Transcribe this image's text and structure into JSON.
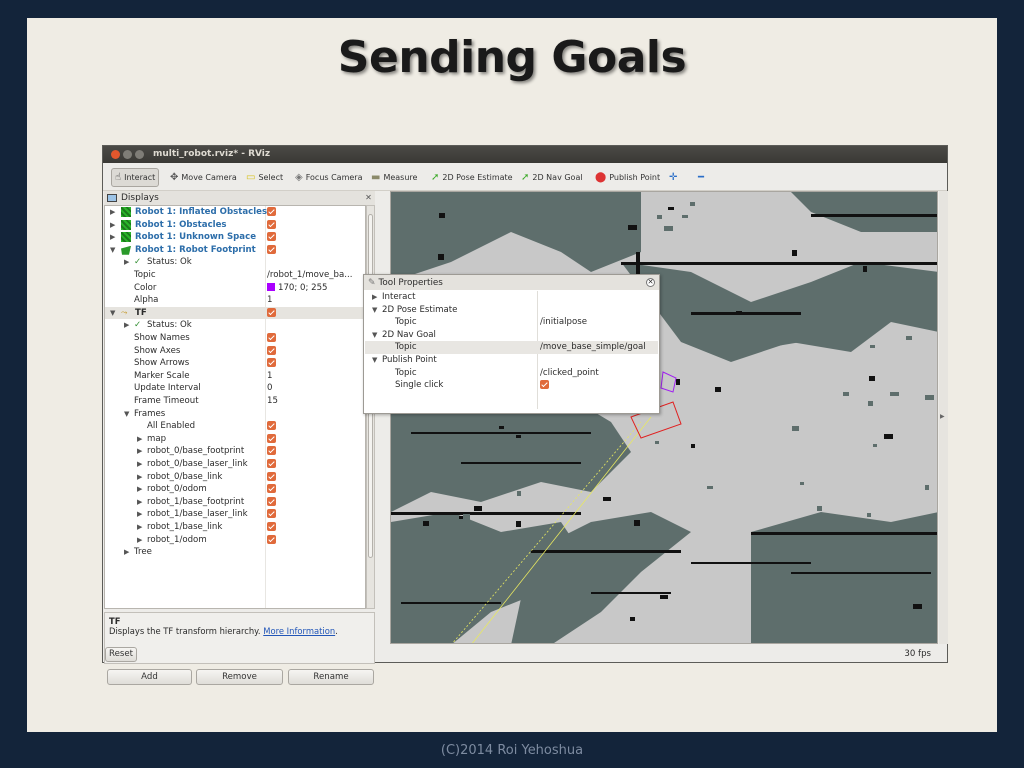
{
  "slide": {
    "title": "Sending Goals",
    "footer": "(C)2014 Roi Yehoshua"
  },
  "window": {
    "title": "multi_robot.rviz* - RViz"
  },
  "toolbar": {
    "tools": [
      {
        "label": "Interact",
        "icon": "hand-icon",
        "glyph": "☝",
        "active": true
      },
      {
        "label": "Move Camera",
        "icon": "move-camera-icon",
        "glyph": "✥"
      },
      {
        "label": "Select",
        "icon": "select-icon",
        "glyph": "▭"
      },
      {
        "label": "Focus Camera",
        "icon": "focus-camera-icon",
        "glyph": "◈"
      },
      {
        "label": "Measure",
        "icon": "measure-icon",
        "glyph": "▬"
      },
      {
        "label": "2D Pose Estimate",
        "icon": "pose-estimate-icon",
        "glyph": "➚"
      },
      {
        "label": "2D Nav Goal",
        "icon": "nav-goal-icon",
        "glyph": "➚"
      },
      {
        "label": "Publish Point",
        "icon": "map-pin-icon",
        "glyph": "⬤"
      },
      {
        "label": "",
        "icon": "plus-icon",
        "glyph": "✛"
      },
      {
        "label": "",
        "icon": "minus-icon",
        "glyph": "━"
      }
    ]
  },
  "displays": {
    "header": "Displays",
    "rows": [
      {
        "label": "Robot 1: Inflated Obstacles",
        "indent": 0,
        "arrow": "▶",
        "icon": "grid-icon",
        "blue": true,
        "checked": true
      },
      {
        "label": "Robot 1: Obstacles",
        "indent": 0,
        "arrow": "▶",
        "icon": "grid-icon",
        "blue": true,
        "checked": true
      },
      {
        "label": "Robot 1: Unknown Space",
        "indent": 0,
        "arrow": "▶",
        "icon": "grid-icon",
        "blue": true,
        "checked": true
      },
      {
        "label": "Robot 1: Robot Footprint",
        "indent": 0,
        "arrow": "▼",
        "icon": "footprint-icon",
        "blue": true,
        "checked": true
      },
      {
        "label": "Status: Ok",
        "indent": 1,
        "arrow": "▶",
        "status": true
      },
      {
        "label": "Topic",
        "indent": 2,
        "value": "/robot_1/move_ba..."
      },
      {
        "label": "Color",
        "indent": 2,
        "value": "170; 0; 255",
        "swatch": "#aa00ff"
      },
      {
        "label": "Alpha",
        "indent": 2,
        "value": "1"
      },
      {
        "label": "TF",
        "indent": 0,
        "arrow": "▼",
        "icon": "tf-icon",
        "bold": true,
        "checked": true,
        "highlight": true
      },
      {
        "label": "Status: Ok",
        "indent": 1,
        "arrow": "▶",
        "status": true
      },
      {
        "label": "Show Names",
        "indent": 2,
        "checked": true
      },
      {
        "label": "Show Axes",
        "indent": 2,
        "checked": true
      },
      {
        "label": "Show Arrows",
        "indent": 2,
        "checked": true
      },
      {
        "label": "Marker Scale",
        "indent": 2,
        "value": "1"
      },
      {
        "label": "Update Interval",
        "indent": 2,
        "value": "0"
      },
      {
        "label": "Frame Timeout",
        "indent": 2,
        "value": "15"
      },
      {
        "label": "Frames",
        "indent": 1,
        "arrow": "▼"
      },
      {
        "label": "All Enabled",
        "indent": 3,
        "checked": true
      },
      {
        "label": "map",
        "indent": 3,
        "arrow": "▶",
        "checked": true
      },
      {
        "label": "robot_0/base_footprint",
        "indent": 3,
        "arrow": "▶",
        "checked": true
      },
      {
        "label": "robot_0/base_laser_link",
        "indent": 3,
        "arrow": "▶",
        "checked": true
      },
      {
        "label": "robot_0/base_link",
        "indent": 3,
        "arrow": "▶",
        "checked": true
      },
      {
        "label": "robot_0/odom",
        "indent": 3,
        "arrow": "▶",
        "checked": true
      },
      {
        "label": "robot_1/base_footprint",
        "indent": 3,
        "arrow": "▶",
        "checked": true
      },
      {
        "label": "robot_1/base_laser_link",
        "indent": 3,
        "arrow": "▶",
        "checked": true
      },
      {
        "label": "robot_1/base_link",
        "indent": 3,
        "arrow": "▶",
        "checked": true
      },
      {
        "label": "robot_1/odom",
        "indent": 3,
        "arrow": "▶",
        "checked": true
      },
      {
        "label": "Tree",
        "indent": 1,
        "arrow": "▶"
      }
    ],
    "description": {
      "title": "TF",
      "text": "Displays the TF transform hierarchy. ",
      "link": "More Information",
      "tail": "."
    },
    "buttons": {
      "add": "Add",
      "remove": "Remove",
      "rename": "Rename"
    }
  },
  "tool_properties": {
    "title": "Tool Properties",
    "rows": [
      {
        "label": "Interact",
        "indent": 0,
        "arrow": "▶"
      },
      {
        "label": "2D Pose Estimate",
        "indent": 0,
        "arrow": "▼"
      },
      {
        "label": "Topic",
        "indent": 2,
        "value": "/initialpose"
      },
      {
        "label": "2D Nav Goal",
        "indent": 0,
        "arrow": "▼"
      },
      {
        "label": "Topic",
        "indent": 2,
        "value": "/move_base_simple/goal",
        "highlight": true
      },
      {
        "label": "Publish Point",
        "indent": 0,
        "arrow": "▼"
      },
      {
        "label": "Topic",
        "indent": 2,
        "value": "/clicked_point"
      },
      {
        "label": "Single click",
        "indent": 2,
        "checked": true
      }
    ]
  },
  "statusbar": {
    "reset": "Reset",
    "fps": "30 fps"
  },
  "colors": {
    "checkbox": "#e06a3b",
    "display_blue": "#2d6eaa",
    "map_free": "#c8c8c8",
    "map_inflated": "#5e6e6c",
    "map_obstacle": "#111111"
  }
}
